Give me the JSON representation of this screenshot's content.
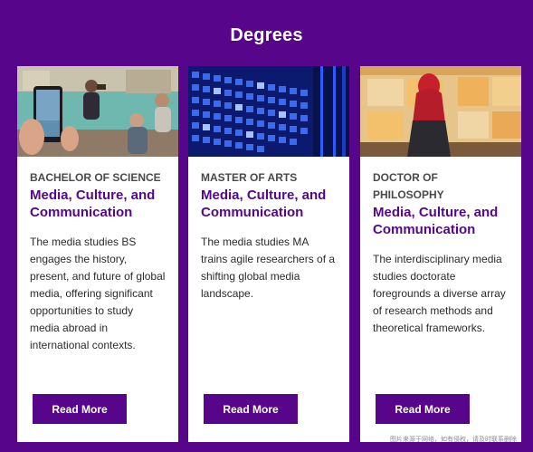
{
  "page": {
    "title": "Degrees"
  },
  "cards": [
    {
      "kicker": "BACHELOR OF SCIENCE",
      "title": "Media, Culture, and Communication",
      "description": "The media studies BS engages the history, present, and future of global media, offering significant opportunities to study media abroad in international contexts.",
      "button_label": "Read More"
    },
    {
      "kicker": "MASTER OF ARTS",
      "title": "Media, Culture, and Communication",
      "description": "The media studies MA trains agile researchers of a shifting global media landscape.",
      "button_label": "Read More"
    },
    {
      "kicker": "DOCTOR OF PHILOSOPHY",
      "title": "Media, Culture, and Communication",
      "description": "The interdisciplinary media studies doctorate foregrounds a diverse array of research methods and theoretical frameworks.",
      "button_label": "Read More"
    }
  ],
  "watermark": "图片来源于网络，如有侵权，请及时联系删除",
  "colors": {
    "brand_purple": "#57068c",
    "card_background": "#ffffff",
    "text_dark": "#2b2b2b"
  }
}
